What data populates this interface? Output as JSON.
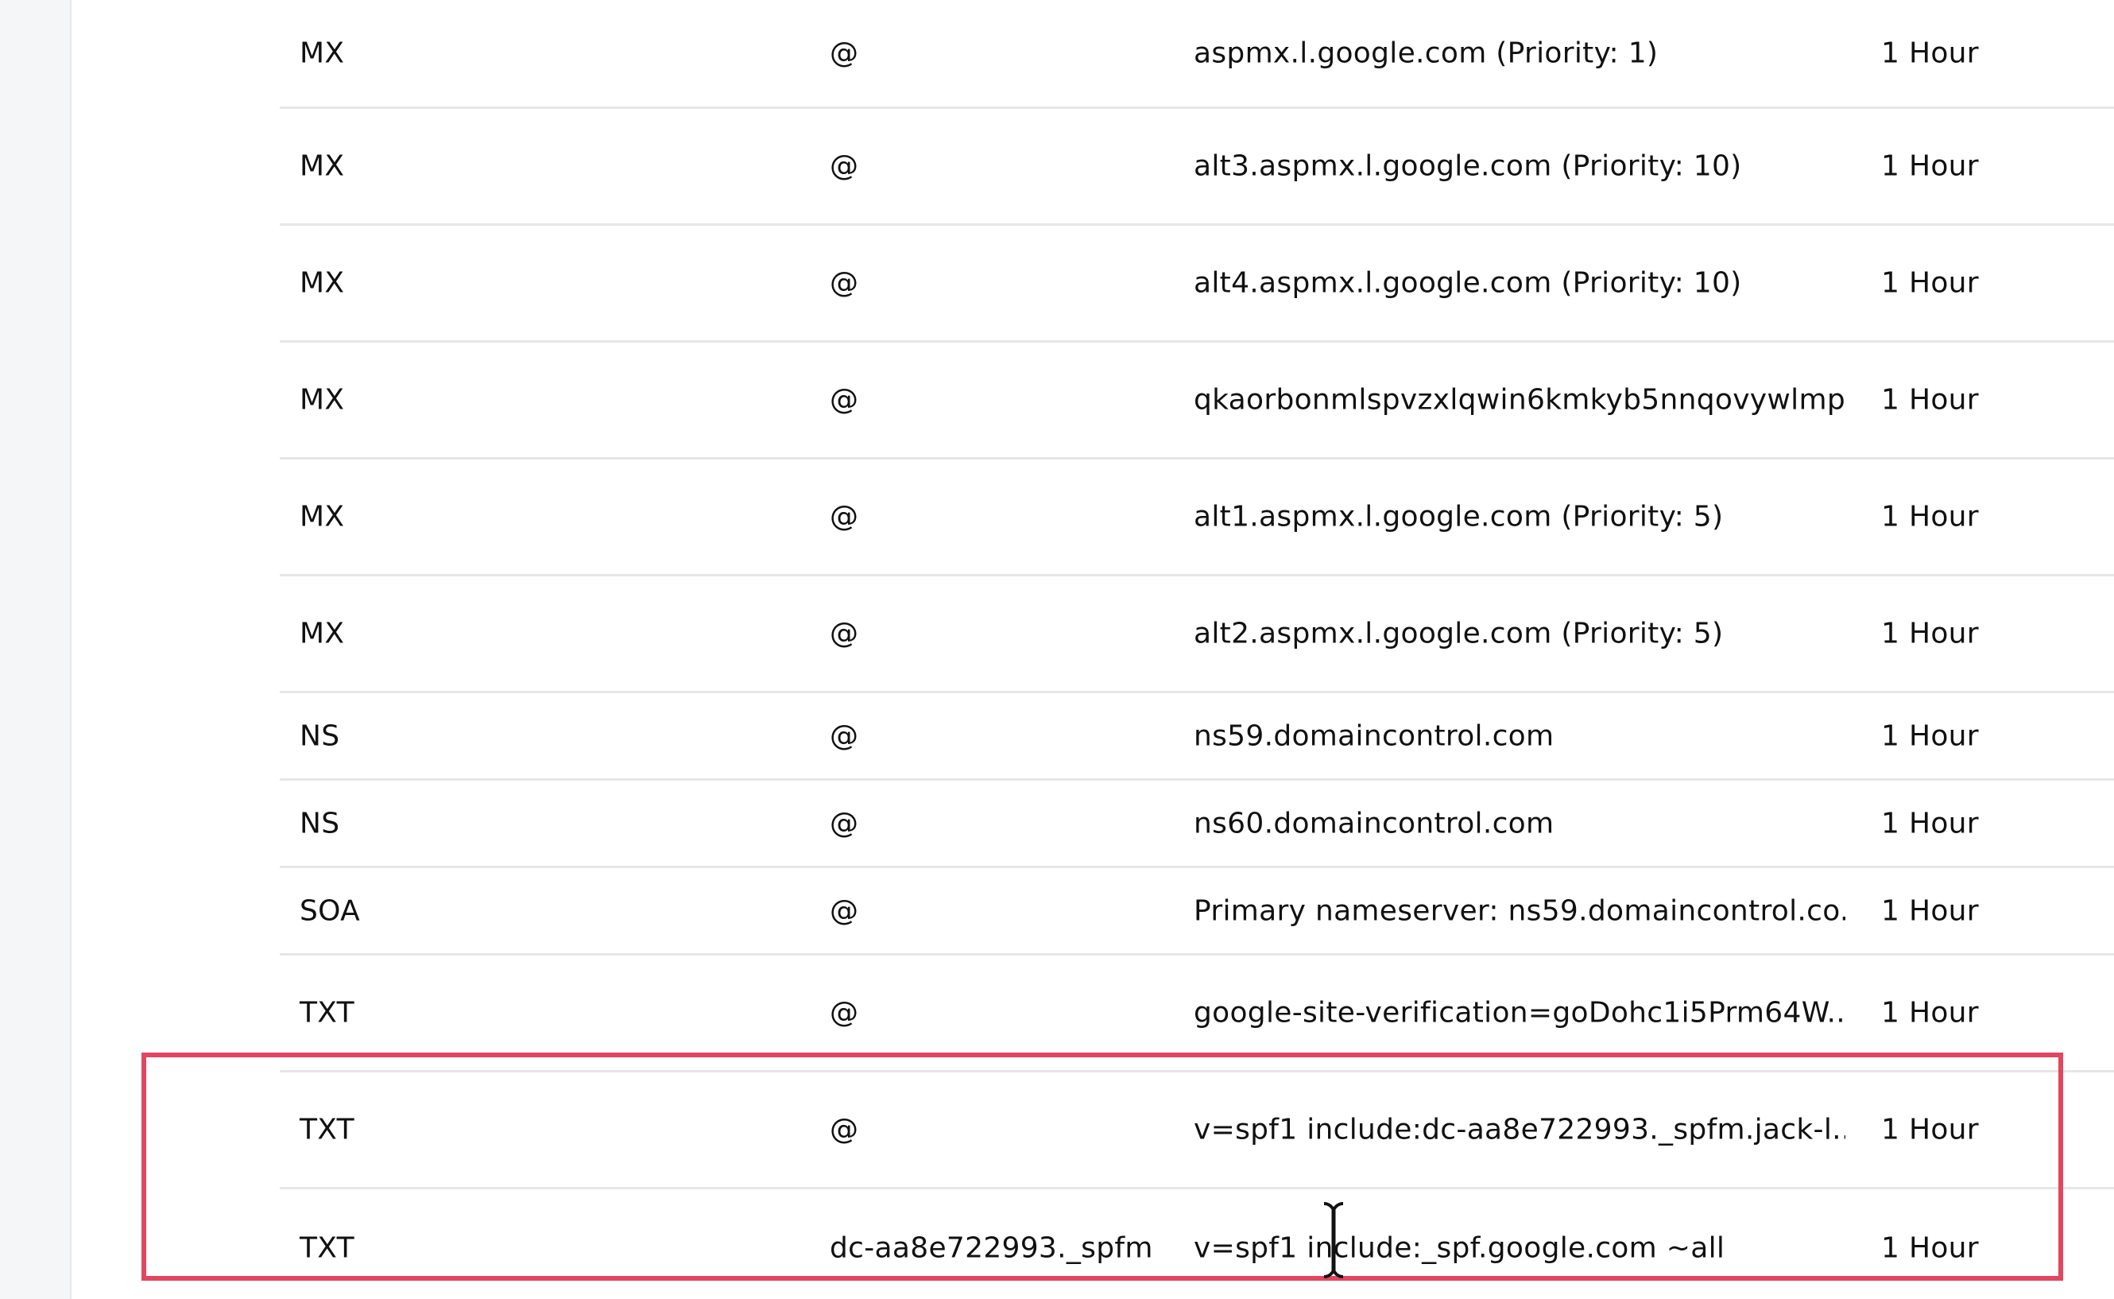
{
  "records": [
    {
      "type": "MX",
      "name": "@",
      "value": "aspmx.l.google.com (Priority: 1)",
      "ttl": "1 Hour"
    },
    {
      "type": "MX",
      "name": "@",
      "value": "alt3.aspmx.l.google.com (Priority: 10)",
      "ttl": "1 Hour"
    },
    {
      "type": "MX",
      "name": "@",
      "value": "alt4.aspmx.l.google.com (Priority: 10)",
      "ttl": "1 Hour"
    },
    {
      "type": "MX",
      "name": "@",
      "value": "qkaorbonmlspvzxlqwin6kmkyb5nnqovywlmp...",
      "ttl": "1 Hour"
    },
    {
      "type": "MX",
      "name": "@",
      "value": "alt1.aspmx.l.google.com (Priority: 5)",
      "ttl": "1 Hour"
    },
    {
      "type": "MX",
      "name": "@",
      "value": "alt2.aspmx.l.google.com (Priority: 5)",
      "ttl": "1 Hour"
    },
    {
      "type": "NS",
      "name": "@",
      "value": "ns59.domaincontrol.com",
      "ttl": "1 Hour"
    },
    {
      "type": "NS",
      "name": "@",
      "value": "ns60.domaincontrol.com",
      "ttl": "1 Hour"
    },
    {
      "type": "SOA",
      "name": "@",
      "value": "Primary nameserver: ns59.domaincontrol.co...",
      "ttl": "1 Hour"
    },
    {
      "type": "TXT",
      "name": "@",
      "value": "google-site-verification=goDohc1i5Prm64W...",
      "ttl": "1 Hour"
    },
    {
      "type": "TXT",
      "name": "@",
      "value": "v=spf1 include:dc-aa8e722993._spfm.jack-l...",
      "ttl": "1 Hour"
    },
    {
      "type": "TXT",
      "name": "dc-aa8e722993._spfm",
      "value": "v=spf1 include:_spf.google.com ~all",
      "ttl": "1 Hour"
    }
  ],
  "highlight": {
    "color": "#e3465f",
    "icon": "text-cursor-icon"
  }
}
